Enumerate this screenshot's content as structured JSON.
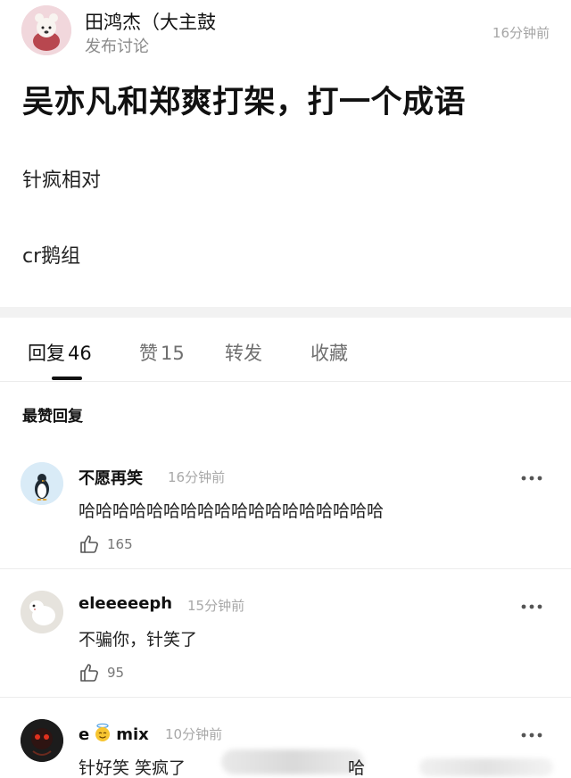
{
  "post": {
    "author": "田鸿杰（大主鼓",
    "action": "发布讨论",
    "time": "16分钟前",
    "title": "吴亦凡和郑爽打架，打一个成语",
    "lines": [
      "针疯相对",
      "cr鹅组"
    ]
  },
  "tabs": [
    {
      "label": "回复",
      "count": "46"
    },
    {
      "label": "赞",
      "count": "15"
    },
    {
      "label": "转发"
    },
    {
      "label": "收藏"
    }
  ],
  "section_label": "最赞回复",
  "comments": [
    {
      "name": "不愿再笑",
      "time": "16分钟前",
      "text": "哈哈哈哈哈哈哈哈哈哈哈哈哈哈哈哈哈哈",
      "likes": "165"
    },
    {
      "name": "eleeeeeph",
      "time": "15分钟前",
      "text": "不骗你，针笑了",
      "likes": "95"
    },
    {
      "name_pre": "e",
      "name_post": "mix",
      "time": "10分钟前",
      "text": "针好笑 笑疯了",
      "text_tail": "哈"
    }
  ],
  "icons": {
    "more": "more-dots-icon",
    "like": "thumbs-up-icon",
    "emoji": "halo-smile-emoji"
  }
}
